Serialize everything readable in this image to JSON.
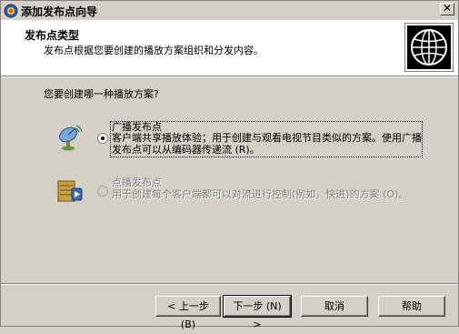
{
  "window": {
    "title": "添加发布点向导",
    "close_glyph": "✕"
  },
  "header": {
    "title": "发布点类型",
    "subtitle": "发布点根据您要创建的播放方案组织和分发内容。"
  },
  "main": {
    "prompt": "您要创建哪一种播放方案?",
    "options": [
      {
        "label": "广播发布点",
        "description": "客户端共享播放体验；用于创建与观看电视节目类似的方案。使用广播发布点可以从编码器传递流 (R)。",
        "selected": true,
        "enabled": true,
        "icon": "broadcast-dish-icon"
      },
      {
        "label": "点播发布点",
        "description": "用于创建每个客户端都可以对流进行控制(例如，快进)的方案 (O)。",
        "selected": false,
        "enabled": false,
        "icon": "on-demand-server-icon"
      }
    ]
  },
  "footer": {
    "back_label": "< 上一步 (B)",
    "next_label": "下一步 (N) >",
    "cancel_label": "取消",
    "help_label": "帮助"
  }
}
